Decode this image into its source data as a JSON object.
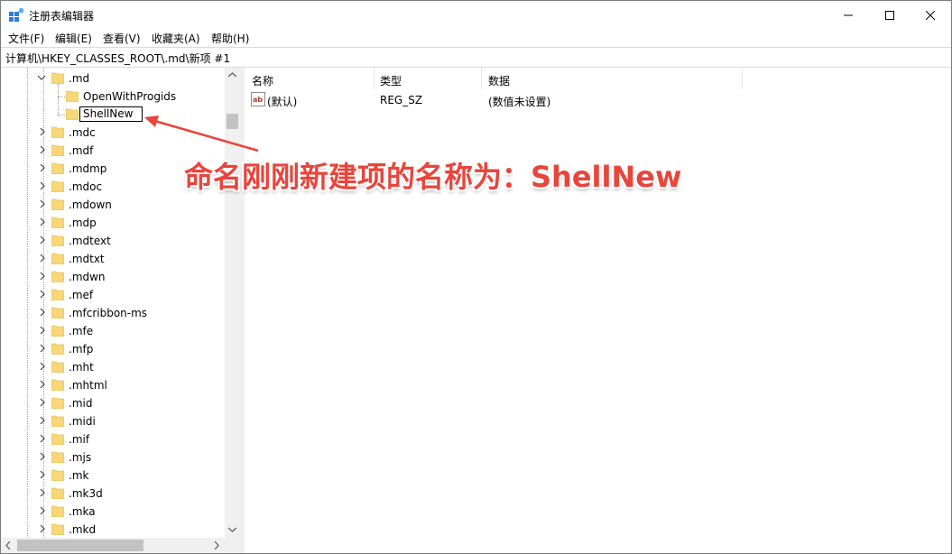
{
  "window": {
    "title": "注册表编辑器",
    "icon": "regedit-icon"
  },
  "menu": [
    "文件(F)",
    "编辑(E)",
    "查看(V)",
    "收藏夹(A)",
    "帮助(H)"
  ],
  "address": "计算机\\HKEY_CLASSES_ROOT\\.md\\新项 #1",
  "tree": {
    "expanded_parent": ".md",
    "children": [
      "OpenWithProgids"
    ],
    "rename_value": "ShellNew",
    "siblings": [
      ".mdc",
      ".mdf",
      ".mdmp",
      ".mdoc",
      ".mdown",
      ".mdp",
      ".mdtext",
      ".mdtxt",
      ".mdwn",
      ".mef",
      ".mfcribbon-ms",
      ".mfe",
      ".mfp",
      ".mht",
      ".mhtml",
      ".mid",
      ".midi",
      ".mif",
      ".mjs",
      ".mk",
      ".mk3d",
      ".mka",
      ".mkd"
    ]
  },
  "list": {
    "columns": [
      "名称",
      "类型",
      "数据"
    ],
    "rows": [
      {
        "name": "(默认)",
        "type": "REG_SZ",
        "data": "(数值未设置)"
      }
    ]
  },
  "annotation": "命名刚刚新建项的名称为：ShellNew",
  "colors": {
    "folder": "#f7d778",
    "annotation": "#e8453c",
    "arrow": "#e8453c"
  }
}
